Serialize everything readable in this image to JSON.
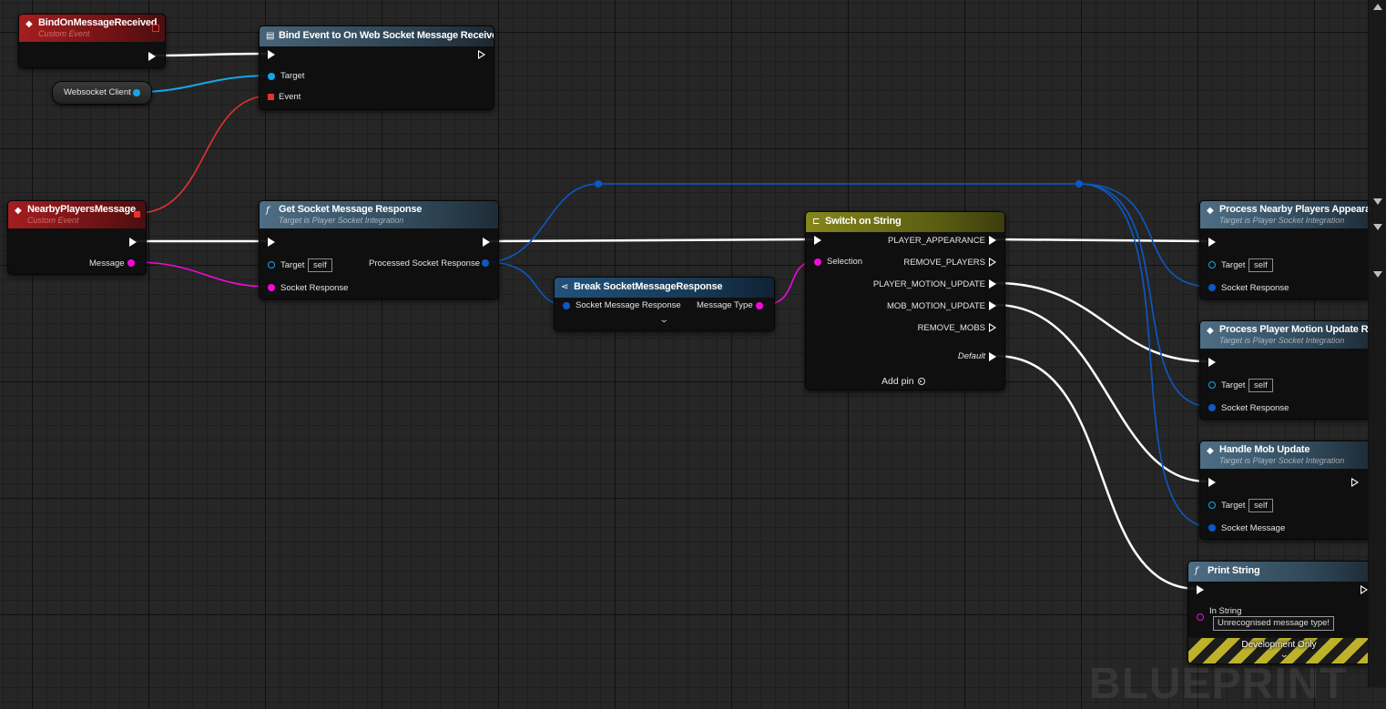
{
  "watermark": "BLUEPRINT",
  "colors": {
    "exec": "#ffffff",
    "struct_pin": "#0d58c4",
    "string_pin": "#f20ad8",
    "object_pin": "#16a6e8",
    "delegate_pin": "#e53030",
    "event_header": "#a51e20",
    "function_header": "#4e6e85",
    "switch_header": "#85861b"
  },
  "nodes": {
    "bind_on_message_received": {
      "title": "BindOnMessageReceived",
      "subtitle": "Custom Event",
      "icon": "event-diamond-icon"
    },
    "bind_event": {
      "title": "Bind Event to On Web Socket Message Received",
      "icon": "bind-event-icon",
      "pins": {
        "target": "Target",
        "event": "Event"
      }
    },
    "websocket_client": {
      "label": "Websocket Client"
    },
    "nearby_players_message": {
      "title": "NearbyPlayersMessage",
      "subtitle": "Custom Event",
      "icon": "event-diamond-icon",
      "pins": {
        "message": "Message"
      }
    },
    "get_socket_message_response": {
      "title": "Get Socket Message Response",
      "subtitle": "Target is Player Socket Integration",
      "icon": "function-icon",
      "pins": {
        "target": "Target",
        "target_value": "self",
        "socket_response": "Socket Response",
        "processed": "Processed Socket Response"
      }
    },
    "break_socket_message_response": {
      "title": "Break SocketMessageResponse",
      "icon": "break-struct-icon",
      "pins": {
        "socket_message_response": "Socket Message Response",
        "message_type": "Message Type"
      }
    },
    "switch_on_string": {
      "title": "Switch on String",
      "icon": "switch-icon",
      "selection": "Selection",
      "outputs": [
        "PLAYER_APPEARANCE",
        "REMOVE_PLAYERS",
        "PLAYER_MOTION_UPDATE",
        "MOB_MOTION_UPDATE",
        "REMOVE_MOBS"
      ],
      "default": "Default",
      "add_pin": "Add pin"
    },
    "process_nearby_players_appearance": {
      "title": "Process Nearby Players Appearance",
      "subtitle": "Target is Player Socket Integration",
      "icon": "function-icon",
      "pins": {
        "target": "Target",
        "target_value": "self",
        "socket_response": "Socket Response"
      }
    },
    "process_player_motion_update": {
      "title": "Process Player Motion Update Response",
      "subtitle": "Target is Player Socket Integration",
      "icon": "function-icon",
      "pins": {
        "target": "Target",
        "target_value": "self",
        "socket_response": "Socket Response"
      }
    },
    "handle_mob_update": {
      "title": "Handle Mob Update",
      "subtitle": "Target is Player Socket Integration",
      "icon": "function-icon",
      "pins": {
        "target": "Target",
        "target_value": "self",
        "socket_message": "Socket Message"
      }
    },
    "print_string": {
      "title": "Print String",
      "icon": "function-icon",
      "pins": {
        "in_string": "In String",
        "in_string_value": "Unrecognised message type!"
      },
      "development_only": "Development Only"
    }
  }
}
